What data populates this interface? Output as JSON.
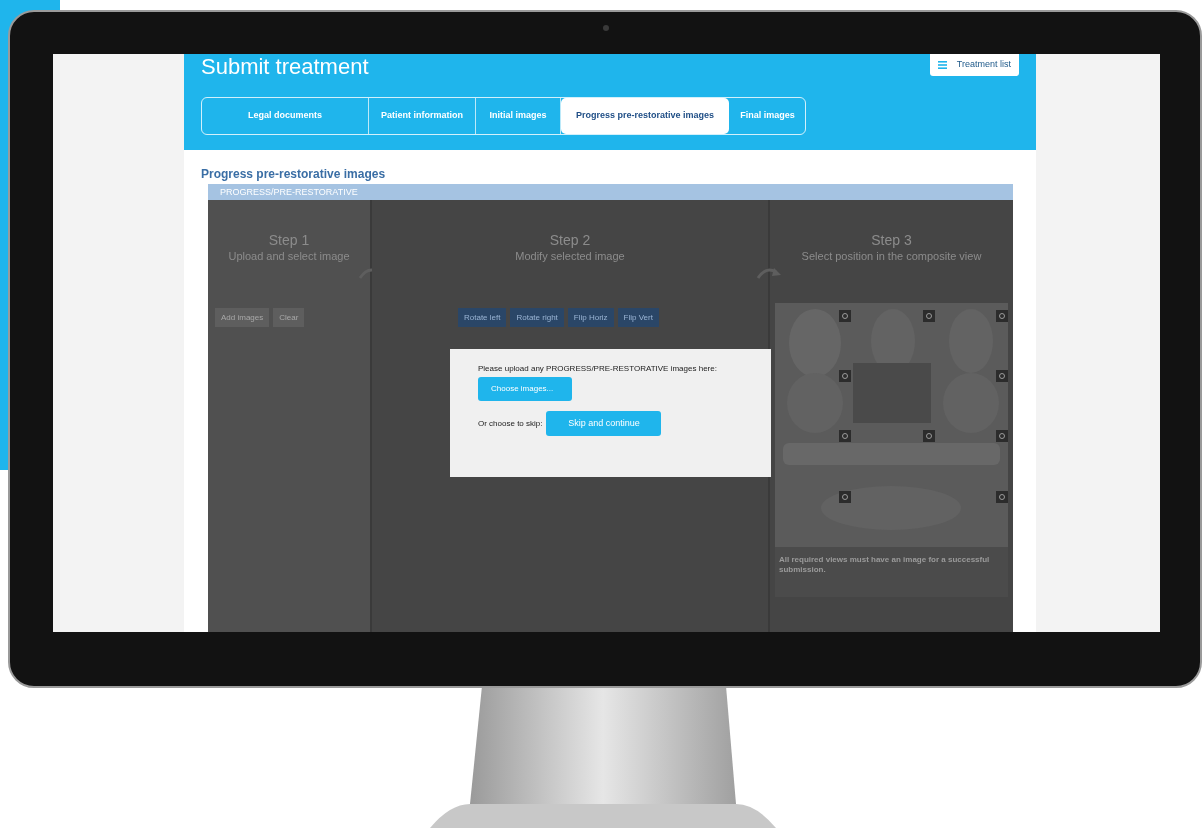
{
  "header": {
    "title": "Submit treatment",
    "menu_button": "Treatment list"
  },
  "tabs": [
    {
      "label": "Legal documents",
      "selected": false
    },
    {
      "label": "Patient information",
      "selected": false
    },
    {
      "label": "Initial images",
      "selected": false
    },
    {
      "label": "Progress pre-restorative images",
      "selected": true
    },
    {
      "label": "Final images",
      "selected": false
    }
  ],
  "section_title": "Progress pre-restorative images",
  "panel": {
    "title": "PROGRESS/PRE-RESTORATIVE",
    "steps": [
      {
        "kind": "upload",
        "title": "Step 1",
        "subtitle": "Upload and select image",
        "buttons": [
          "Add images",
          "Clear"
        ]
      },
      {
        "kind": "modify",
        "title": "Step 2",
        "subtitle": "Modify selected image",
        "buttons": [
          "Rotate left",
          "Rotate right",
          "Flip Horiz",
          "Flip Vert"
        ]
      },
      {
        "kind": "position",
        "title": "Step 3",
        "subtitle": "Select position in the composite view",
        "note": "All required views must have an image for a successful submission."
      }
    ]
  },
  "dialog": {
    "prompt": "Please upload any PROGRESS/PRE-RESTORATIVE images here:",
    "choose_button": "Choose images...",
    "skip_label": "Or choose to skip:",
    "skip_button": "Skip and continue"
  }
}
